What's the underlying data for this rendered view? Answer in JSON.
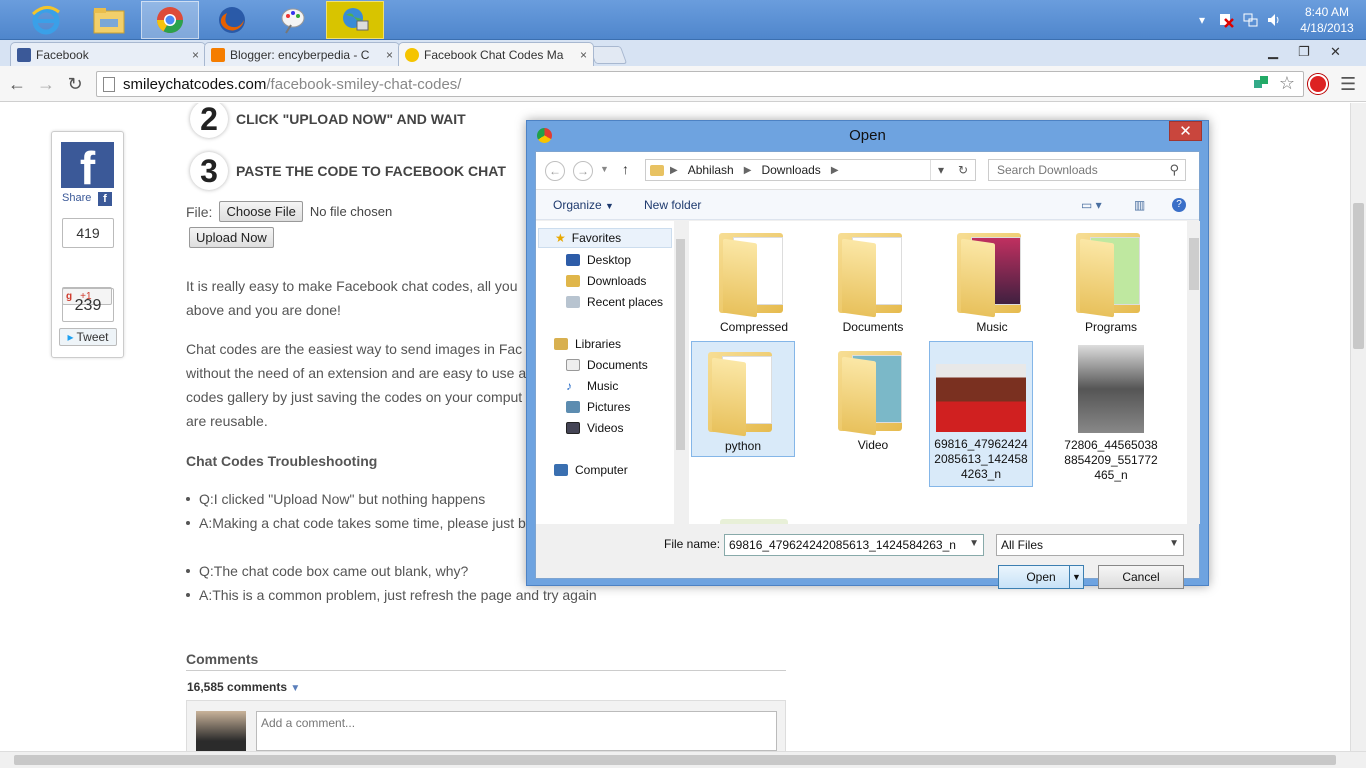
{
  "taskbar": {
    "clock_time": "8:40 AM",
    "clock_date": "4/18/2013",
    "apps": [
      "internet-explorer",
      "file-explorer",
      "chrome",
      "firefox",
      "paint",
      "network-app"
    ]
  },
  "browser": {
    "tabs": [
      {
        "label": "Facebook",
        "color": "#3b5998"
      },
      {
        "label": "Blogger: encyberpedia - C",
        "color": "#f57d00"
      },
      {
        "label": "Facebook Chat Codes Ma",
        "color": "#f5c400"
      }
    ],
    "close_glyph": "×",
    "url_host": "smileychatcodes.com",
    "url_path": "/facebook-smiley-chat-codes/"
  },
  "page": {
    "share_label": "Share",
    "share_count": "419",
    "gplus_label": "+1",
    "tweet_count": "239",
    "tweet_label": "Tweet",
    "step2_num": "2",
    "step2_label": "CLICK \"UPLOAD NOW\" AND WAIT",
    "step3_num": "3",
    "step3_label": "PASTE THE CODE TO FACEBOOK CHAT",
    "file_label": "File:",
    "choose_file": "Choose File",
    "no_file": "No file chosen",
    "upload_now": "Upload Now",
    "para1_line1": "It is really easy to make Facebook chat codes, all you",
    "para1_line2": "above and you are done!",
    "para2_line1": "Chat codes are the easiest way to send images in Fac",
    "para2_line2": "without the need of an extension and are easy to use a",
    "para2_line3": "codes gallery by just saving the codes on your comput",
    "para2_line4": "are reusable.",
    "troubleshoot_heading": "Chat Codes Troubleshooting",
    "q1": "Q:I clicked \"Upload Now\" but nothing happens",
    "a1": "A:Making a chat code takes some time, please just b",
    "q2": "Q:The chat code box came out blank, why?",
    "a2": "A:This is a common problem, just refresh the page and try again",
    "comments_heading": "Comments",
    "comments_count": "16,585 comments",
    "comment_placeholder": "Add a comment..."
  },
  "dialog": {
    "title": "Open",
    "close_glyph": "✕",
    "breadcrumb": [
      "Abhilash",
      "Downloads"
    ],
    "search_placeholder": "Search Downloads",
    "organize": "Organize",
    "new_folder": "New folder",
    "nav": {
      "favorites": "Favorites",
      "desktop": "Desktop",
      "downloads": "Downloads",
      "recent": "Recent places",
      "libraries": "Libraries",
      "documents": "Documents",
      "music": "Music",
      "pictures": "Pictures",
      "videos": "Videos",
      "computer": "Computer"
    },
    "items": [
      {
        "name": "Compressed"
      },
      {
        "name": "Documents"
      },
      {
        "name": "Music"
      },
      {
        "name": "Programs"
      },
      {
        "name": "python"
      },
      {
        "name": "Video"
      },
      {
        "name": "69816_479624242085613_1424584263_n"
      },
      {
        "name": "72806_445650388854209_551772465_n"
      }
    ],
    "filename_label": "File name:",
    "filename_value": "69816_479624242085613_1424584263_n",
    "filter_value": "All Files",
    "open_button": "Open",
    "cancel_button": "Cancel"
  }
}
